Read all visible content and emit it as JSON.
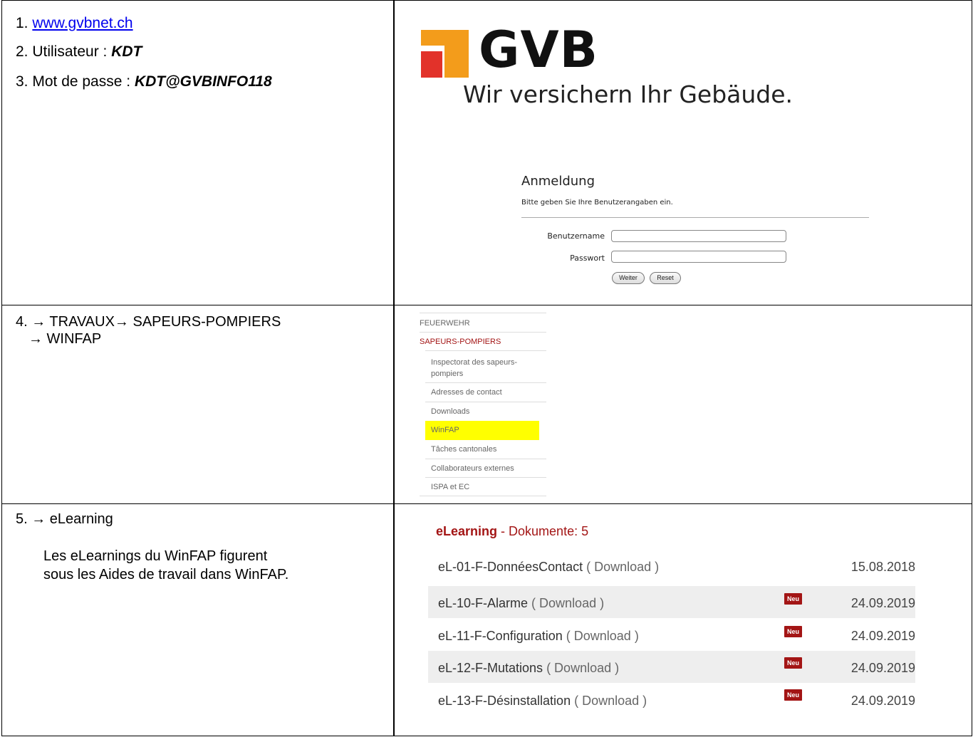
{
  "row1": {
    "step1_prefix": "1. ",
    "step1_link": "www.gvbnet.ch",
    "step2_prefix": "2. Utilisateur : ",
    "step2_value": "KDT",
    "step3_prefix": "3. Mot de passe : ",
    "step3_value": "KDT@GVBINFO118",
    "logo_text": "GVB",
    "slogan": "Wir versichern Ihr Gebäude.",
    "login_title": "Anmeldung",
    "login_sub": "Bitte geben Sie Ihre Benutzerangaben ein.",
    "username_label": "Benutzername",
    "password_label": "Passwort",
    "submit_label": "Weiter",
    "reset_label": "Reset",
    "colors": {
      "logo_orange": "#f39c1b",
      "logo_red": "#e2322a"
    }
  },
  "row2": {
    "step4_line1": "4.  → TRAVAUX→ SAPEURS-POMPIERS",
    "step4_line2": "→ WINFAP",
    "nav": {
      "feuerwehr": "FEUERWEHR",
      "sapeurs": "SAPEURS-POMPIERS",
      "inspectorat_1": "Inspectorat des sapeurs-",
      "inspectorat_2": "pompiers",
      "adresses": "Adresses de contact",
      "downloads": "Downloads",
      "winfap": "WinFAP",
      "taches": "Tâches cantonales",
      "collaborateurs": "Collaborateurs externes",
      "ispa": "ISPA et EC"
    },
    "colors": {
      "active_red": "#a31515",
      "highlight": "#ffff00"
    }
  },
  "row3": {
    "step5": "5.  → eLearning",
    "note_line1": "Les eLearnings du WinFAP figurent",
    "note_line2": "sous les Aides de travail dans WinFAP.",
    "docs_title_bold": "eLearning",
    "docs_title_rest": " - Dokumente: 5",
    "documents": [
      {
        "name": "eL-01-F-DonnéesContact",
        "download": " ( Download )",
        "badge": "",
        "date": "15.08.2018"
      },
      {
        "name": "eL-10-F-Alarme",
        "download": " ( Download )",
        "badge": "Neu",
        "date": "24.09.2019"
      },
      {
        "name": "eL-11-F-Configuration",
        "download": " ( Download )",
        "badge": "Neu",
        "date": "24.09.2019"
      },
      {
        "name": "eL-12-F-Mutations",
        "download": " ( Download )",
        "badge": "Neu",
        "date": "24.09.2019"
      },
      {
        "name": "eL-13-F-Désinstallation",
        "download": " ( Download )",
        "badge": "Neu",
        "date": "24.09.2019"
      }
    ],
    "colors": {
      "title_red": "#a31515"
    }
  }
}
